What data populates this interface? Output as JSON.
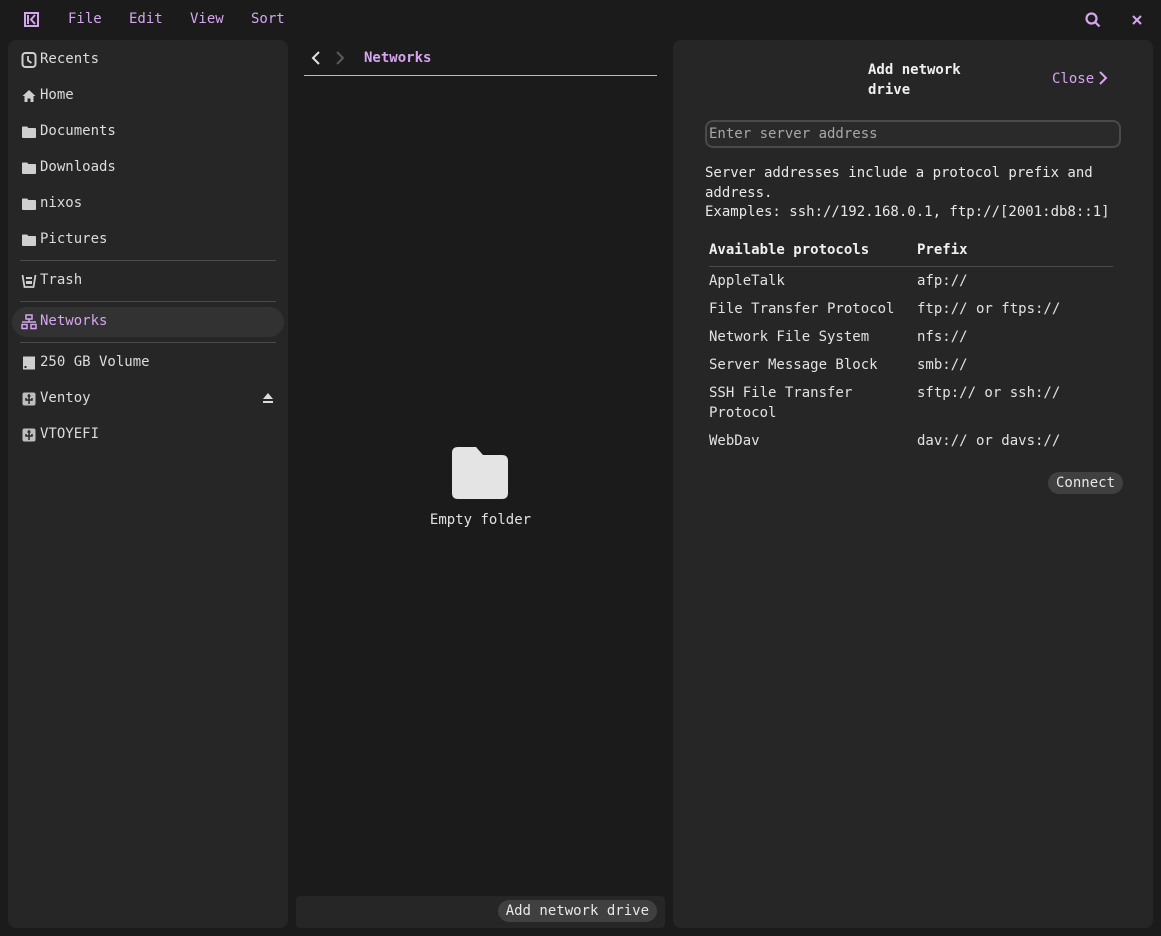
{
  "header": {
    "menus": [
      "File",
      "Edit",
      "View",
      "Sort"
    ],
    "icons": {
      "logo": "sidebar-toggle-icon",
      "search": "search-icon",
      "close": "close-icon"
    }
  },
  "sidebar": {
    "items": [
      {
        "label": "Recents",
        "icon": "clock-icon"
      },
      {
        "label": "Home",
        "icon": "home-icon"
      },
      {
        "label": "Documents",
        "icon": "folder-icon"
      },
      {
        "label": "Downloads",
        "icon": "folder-icon"
      },
      {
        "label": "nixos",
        "icon": "folder-icon"
      },
      {
        "label": "Pictures",
        "icon": "folder-icon"
      },
      {
        "label": "Trash",
        "icon": "trash-icon"
      },
      {
        "label": "Networks",
        "icon": "network-icon",
        "active": true
      },
      {
        "label": "250 GB Volume",
        "icon": "drive-icon"
      },
      {
        "label": "Ventoy",
        "icon": "usb-drive-icon",
        "ejectable": true
      },
      {
        "label": "VTOYEFI",
        "icon": "usb-drive-icon"
      }
    ]
  },
  "center": {
    "breadcrumb": "Networks",
    "empty_label": "Empty folder",
    "add_button": "Add network drive"
  },
  "panel": {
    "title": "Add network drive",
    "close_label": "Close",
    "input_placeholder": "Enter server address",
    "input_value": "",
    "help_line1": "Server addresses include a protocol prefix and",
    "help_line2": "address.",
    "help_line3": "Examples: ssh://192.168.0.1, ftp://[2001:db8::1]",
    "table": {
      "headers": [
        "Available protocols",
        "Prefix"
      ],
      "rows": [
        [
          "AppleTalk",
          "afp://"
        ],
        [
          "File Transfer Protocol",
          "ftp:// or ftps://"
        ],
        [
          "Network File System",
          "nfs://"
        ],
        [
          "Server Message Block",
          "smb://"
        ],
        [
          "SSH File Transfer Protocol",
          "sftp:// or ssh://"
        ],
        [
          "WebDav",
          "dav:// or davs://"
        ]
      ]
    },
    "connect_label": "Connect"
  },
  "colors": {
    "accent": "#d6a5f0",
    "background": "#1b1b1b",
    "surface": "#262626"
  }
}
